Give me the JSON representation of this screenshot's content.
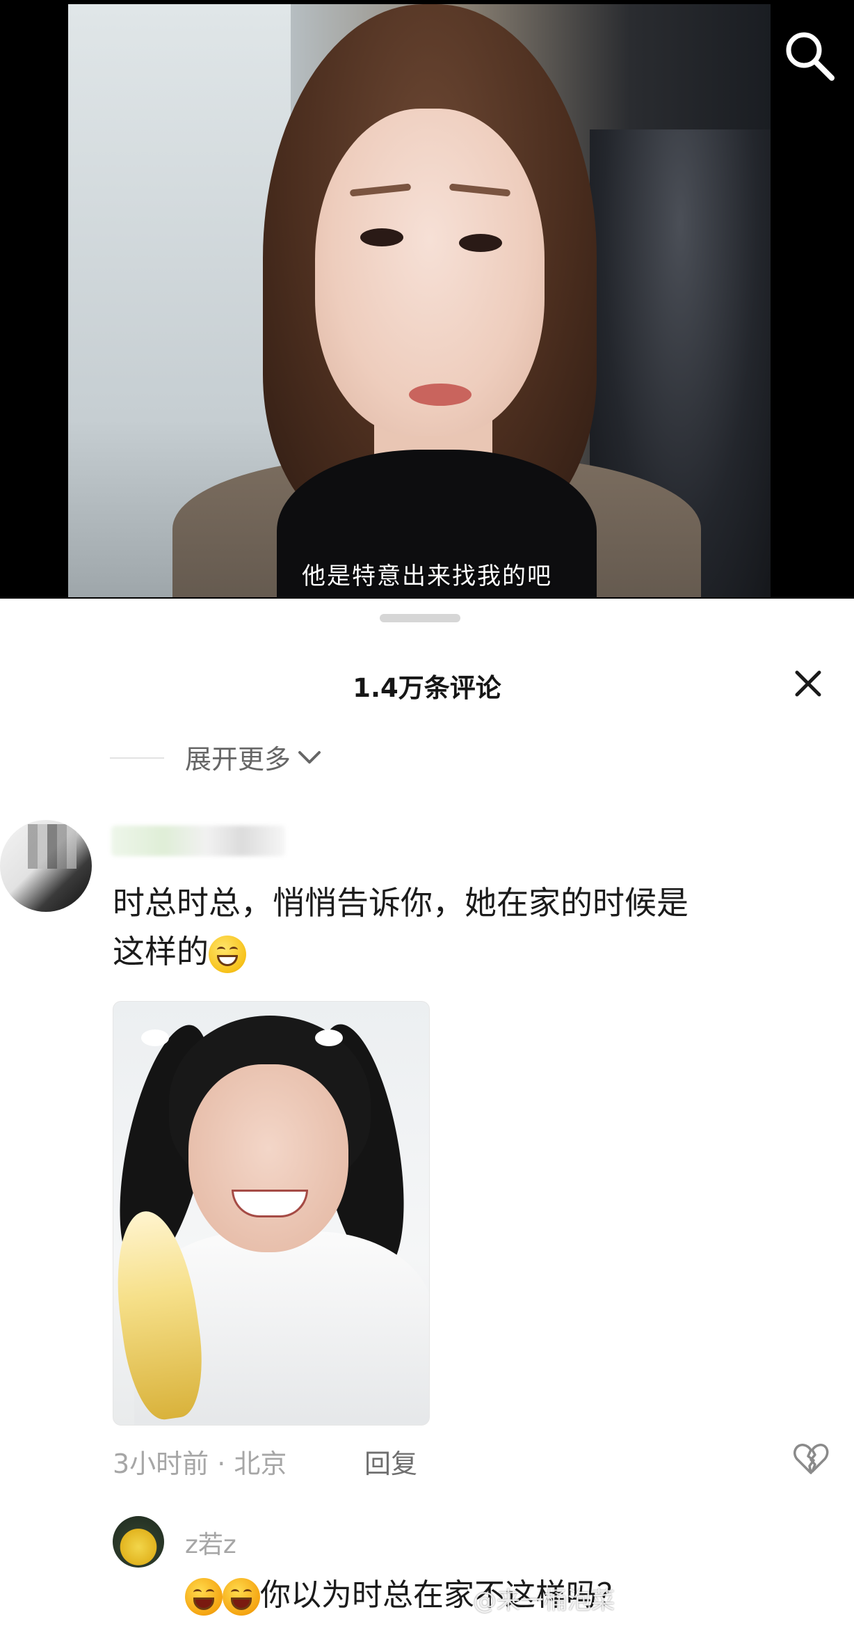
{
  "video": {
    "subtitle": "他是特意出来找我的吧",
    "search_icon": "search-icon"
  },
  "sheet": {
    "title": "1.4万条评论",
    "close_icon": "close-icon",
    "expand_more": "展开更多"
  },
  "comment": {
    "text_line1": "时总时总，悄悄告诉你，她在家的时候是",
    "text_line2": "这样的",
    "emoji": "grin-emoji",
    "meta": "3小时前 · 北京",
    "reply_label": "回复",
    "dislike_icon": "broken-heart-icon"
  },
  "reply": {
    "username": "z若z",
    "text": "你以为时总在家不这样吗？",
    "emoji": "laugh-emoji"
  },
  "watermark": "@来一桶泡菜",
  "colors": {
    "video_bg": "#000000",
    "sheet_bg": "#ffffff",
    "secondary_text": "#a6a6a6"
  }
}
